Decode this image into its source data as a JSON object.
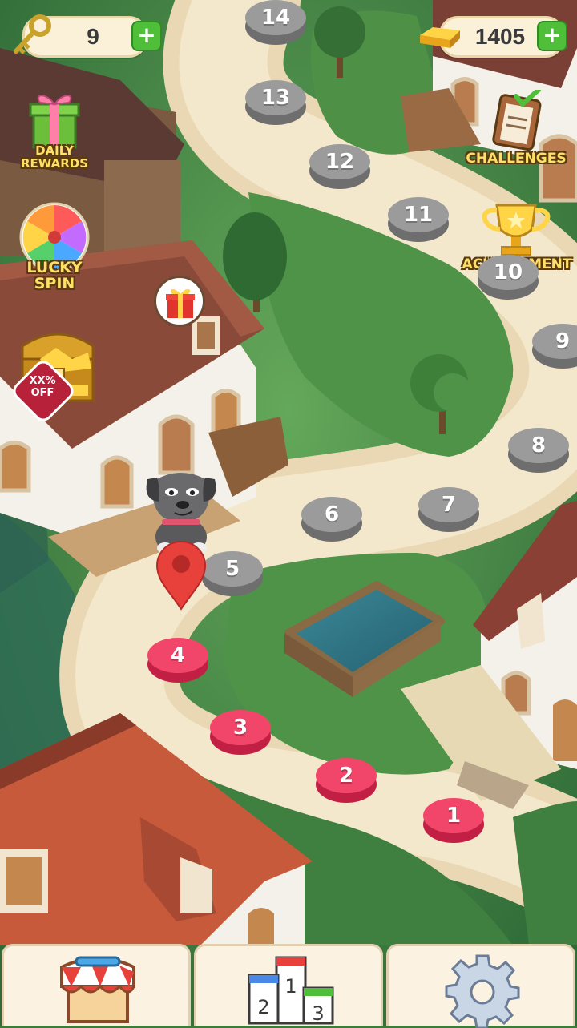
{
  "hud": {
    "keys": "9",
    "gold": "1405",
    "plus": "+"
  },
  "side_menu": {
    "daily_rewards": [
      "DAILY",
      "REWARDS"
    ],
    "lucky_spin": [
      "LUCKY",
      "SPIN"
    ],
    "sale_badge": [
      "XX%",
      "OFF"
    ],
    "challenges": "CHALLENGES",
    "achievement": "ACHIEVEMENT"
  },
  "levels": {
    "completed": [
      "1",
      "2",
      "3",
      "4"
    ],
    "locked": [
      "5",
      "6",
      "7",
      "8",
      "9",
      "10",
      "11",
      "12",
      "13",
      "14"
    ],
    "current": "5"
  },
  "bottom_nav": {
    "leaderboard_places": [
      "1",
      "2",
      "3"
    ]
  },
  "colors": {
    "completed_level": "#e8375a",
    "locked_level": "#8e8e8e",
    "grass": "#4e8f45",
    "path": "#efe0bd",
    "hud_plus": "#4fbf3a"
  }
}
